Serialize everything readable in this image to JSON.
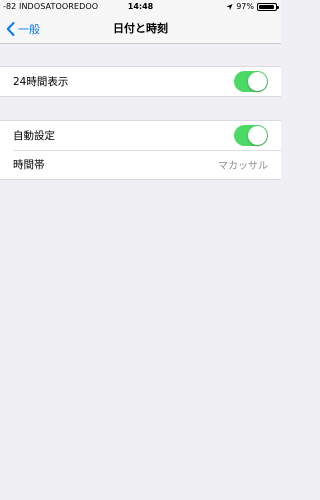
{
  "status_bar": {
    "carrier": "-82 INDOSATOOREDOO",
    "time": "14:48",
    "battery": "97%"
  },
  "nav": {
    "back_label": "一般",
    "title": "日付と時刻"
  },
  "section1": {
    "rows": [
      {
        "label": "24時間表示",
        "toggle_on": true
      }
    ]
  },
  "section2": {
    "rows": [
      {
        "label": "自動設定",
        "toggle_on": true
      },
      {
        "label": "時間帯",
        "value": "マカッサル"
      }
    ]
  },
  "colors": {
    "accent": "#007aff",
    "toggle_on": "#4cd964",
    "background": "#efeff4"
  }
}
